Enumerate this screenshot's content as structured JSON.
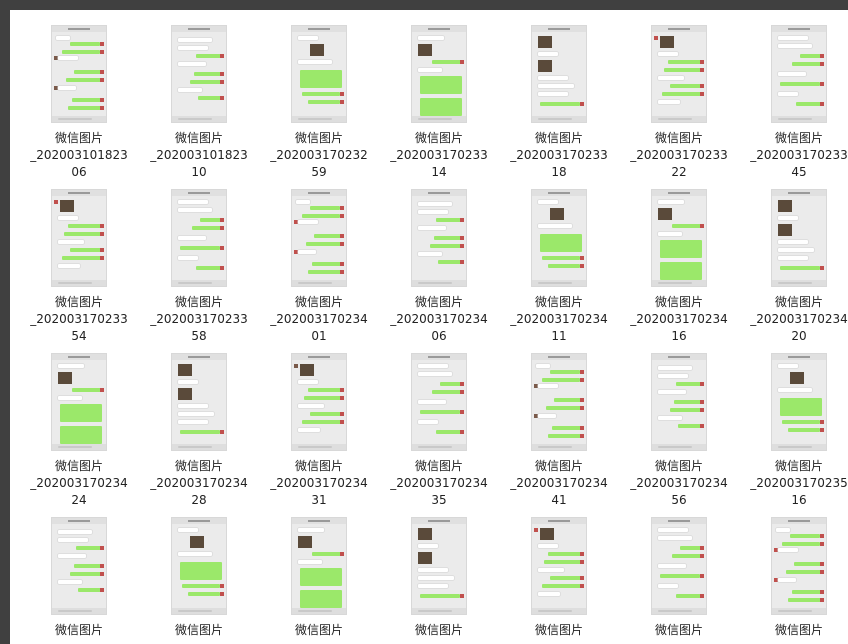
{
  "files": [
    {
      "l1": "微信图片",
      "l2": "_202003101823",
      "l3": "06"
    },
    {
      "l1": "微信图片",
      "l2": "_202003101823",
      "l3": "10"
    },
    {
      "l1": "微信图片",
      "l2": "_202003170232",
      "l3": "59"
    },
    {
      "l1": "微信图片",
      "l2": "_202003170233",
      "l3": "14"
    },
    {
      "l1": "微信图片",
      "l2": "_202003170233",
      "l3": "18"
    },
    {
      "l1": "微信图片",
      "l2": "_202003170233",
      "l3": "22"
    },
    {
      "l1": "微信图片",
      "l2": "_202003170233",
      "l3": "45"
    },
    {
      "l1": "微信图片",
      "l2": "_202003170233",
      "l3": "54"
    },
    {
      "l1": "微信图片",
      "l2": "_202003170233",
      "l3": "58"
    },
    {
      "l1": "微信图片",
      "l2": "_202003170234",
      "l3": "01"
    },
    {
      "l1": "微信图片",
      "l2": "_202003170234",
      "l3": "06"
    },
    {
      "l1": "微信图片",
      "l2": "_202003170234",
      "l3": "11"
    },
    {
      "l1": "微信图片",
      "l2": "_202003170234",
      "l3": "16"
    },
    {
      "l1": "微信图片",
      "l2": "_202003170234",
      "l3": "20"
    },
    {
      "l1": "微信图片",
      "l2": "_202003170234",
      "l3": "24"
    },
    {
      "l1": "微信图片",
      "l2": "_202003170234",
      "l3": "28"
    },
    {
      "l1": "微信图片",
      "l2": "_202003170234",
      "l3": "31"
    },
    {
      "l1": "微信图片",
      "l2": "_202003170234",
      "l3": "35"
    },
    {
      "l1": "微信图片",
      "l2": "_202003170234",
      "l3": "41"
    },
    {
      "l1": "微信图片",
      "l2": "_202003170234",
      "l3": "56"
    },
    {
      "l1": "微信图片",
      "l2": "_202003170235",
      "l3": "16"
    },
    {
      "l1": "微信图片",
      "l2": "",
      "l3": ""
    },
    {
      "l1": "微信图片",
      "l2": "",
      "l3": ""
    },
    {
      "l1": "微信图片",
      "l2": "",
      "l3": ""
    },
    {
      "l1": "微信图片",
      "l2": "",
      "l3": ""
    },
    {
      "l1": "微信图片",
      "l2": "",
      "l3": ""
    },
    {
      "l1": "微信图片",
      "l2": "",
      "l3": ""
    },
    {
      "l1": "微信图片",
      "l2": "",
      "l3": ""
    }
  ],
  "colors": {
    "frame": "#404040",
    "bubble_green": "#9be86a",
    "panel": "#ffffff"
  },
  "icon": "chat-screenshot-thumbnail-icon"
}
